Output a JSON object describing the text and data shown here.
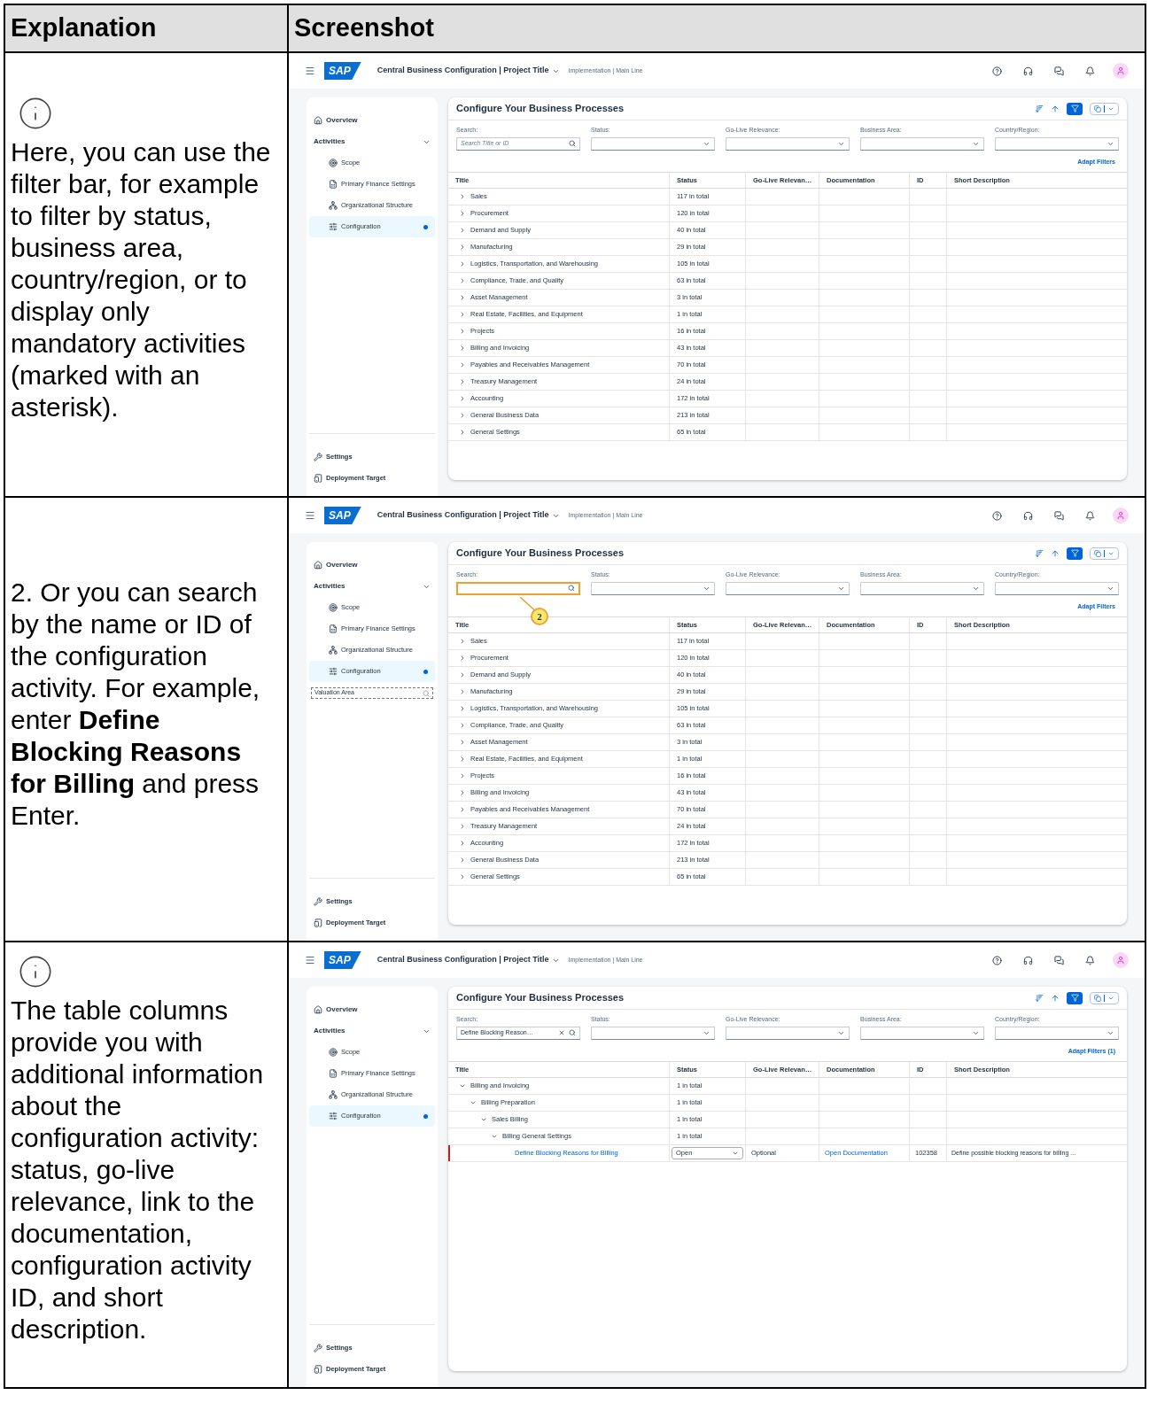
{
  "header": {
    "column_1": "Explanation",
    "column_2": "Screenshot"
  },
  "rows": [
    {
      "kind": "note",
      "explanation": "Here, you can use the filter bar, for example to filter by status, business area, country/region, or to display only mandatory activities (marked with an asterisk).",
      "screenshot": {
        "logo": "SAP",
        "app_title": "Central Business Configuration | Project Title",
        "subtitle": "Implementation | Main Line",
        "sidebar": {
          "items": [
            {
              "label": "Overview",
              "kind": "link",
              "selected": false
            },
            {
              "label": "Activities",
              "kind": "group",
              "expanded": true,
              "children": [
                {
                  "label": "Scope",
                  "selected": false
                },
                {
                  "label": "Primary Finance Settings",
                  "selected": false
                },
                {
                  "label": "Organizational Structure",
                  "selected": false
                },
                {
                  "label": "Configuration",
                  "selected": true
                }
              ]
            }
          ],
          "bottom_items": [
            "Settings",
            "Deployment Target"
          ]
        },
        "page_title": "Configure Your Business Processes",
        "filters": [
          {
            "kind": "search",
            "label": "Search:",
            "placeholder": "Search Title or ID",
            "highlighted": false
          },
          {
            "kind": "select",
            "label": "Status:"
          },
          {
            "kind": "select",
            "label": "Go-Live Relevance:"
          },
          {
            "kind": "select",
            "label": "Business Area:"
          },
          {
            "kind": "select",
            "label": "Country/Region:"
          }
        ],
        "adapt_filters": "Adapt Filters",
        "columns": [
          "Title",
          "Status",
          "Go-Live Relevan…",
          "Documentation",
          "ID",
          "Short Description"
        ],
        "tree": [
          {
            "kind": "group",
            "title": "Sales",
            "status": "117 in total",
            "expanded": false
          },
          {
            "kind": "group",
            "title": "Procurement",
            "status": "120 in total",
            "expanded": false
          },
          {
            "kind": "group",
            "title": "Demand and Supply",
            "status": "40 in total",
            "expanded": false
          },
          {
            "kind": "group",
            "title": "Manufacturing",
            "status": "29 in total",
            "expanded": false
          },
          {
            "kind": "group",
            "title": "Logistics, Transportation, and Warehousing",
            "status": "105 in total",
            "expanded": false
          },
          {
            "kind": "group",
            "title": "Compliance, Trade, and Quality",
            "status": "63 in total",
            "expanded": false
          },
          {
            "kind": "group",
            "title": "Asset Management",
            "status": "3 in total",
            "expanded": false
          },
          {
            "kind": "group",
            "title": "Real Estate, Facilities, and Equipment",
            "status": "1 in total",
            "expanded": false
          },
          {
            "kind": "group",
            "title": "Projects",
            "status": "16 in total",
            "expanded": false
          },
          {
            "kind": "group",
            "title": "Billing and Invoicing",
            "status": "43 in total",
            "expanded": false
          },
          {
            "kind": "group",
            "title": "Payables and Receivables Management",
            "status": "70 in total",
            "expanded": false
          },
          {
            "kind": "group",
            "title": "Treasury Management",
            "status": "24 in total",
            "expanded": false
          },
          {
            "kind": "group",
            "title": "Accounting",
            "status": "172 in total",
            "expanded": false
          },
          {
            "kind": "group",
            "title": "General Business Data",
            "status": "213 in total",
            "expanded": false
          },
          {
            "kind": "group",
            "title": "General Settings",
            "status": "65 in total",
            "expanded": false
          }
        ]
      }
    },
    {
      "kind": "step",
      "explanation": "2. Or you can search by the name or ID of the configuration activity. For example, enter **Define Blocking Reasons for Billing** and press Enter.",
      "screenshot": {
        "logo": "SAP",
        "app_title": "Central Business Configuration | Project Title",
        "subtitle": "Implementation | Main Line",
        "sidebar": {
          "items": [
            {
              "label": "Overview",
              "kind": "link",
              "selected": false
            },
            {
              "label": "Activities",
              "kind": "group",
              "expanded": true,
              "children": [
                {
                  "label": "Scope",
                  "selected": false
                },
                {
                  "label": "Primary Finance Settings",
                  "selected": false
                },
                {
                  "label": "Organizational Structure",
                  "selected": false
                },
                {
                  "label": "Configuration",
                  "selected": true
                }
              ]
            }
          ],
          "search_value": "Valuation Area",
          "bottom_items": [
            "Settings",
            "Deployment Target"
          ]
        },
        "page_title": "Configure Your Business Processes",
        "filters": [
          {
            "kind": "search",
            "label": "Search:",
            "highlighted": true,
            "callout": "2"
          },
          {
            "kind": "select",
            "label": "Status:"
          },
          {
            "kind": "select",
            "label": "Go-Live Relevance:"
          },
          {
            "kind": "select",
            "label": "Business Area:"
          },
          {
            "kind": "select",
            "label": "Country/Region:"
          }
        ],
        "adapt_filters": "Adapt Filters",
        "columns": [
          "Title",
          "Status",
          "Go-Live Relevan…",
          "Documentation",
          "ID",
          "Short Description"
        ],
        "tree": [
          {
            "kind": "group",
            "title": "Sales",
            "status": "117 in total",
            "expanded": false
          },
          {
            "kind": "group",
            "title": "Procurement",
            "status": "120 in total",
            "expanded": false
          },
          {
            "kind": "group",
            "title": "Demand and Supply",
            "status": "40 in total",
            "expanded": false
          },
          {
            "kind": "group",
            "title": "Manufacturing",
            "status": "29 in total",
            "expanded": false
          },
          {
            "kind": "group",
            "title": "Logistics, Transportation, and Warehousing",
            "status": "105 in total",
            "expanded": false
          },
          {
            "kind": "group",
            "title": "Compliance, Trade, and Quality",
            "status": "63 in total",
            "expanded": false
          },
          {
            "kind": "group",
            "title": "Asset Management",
            "status": "3 in total",
            "expanded": false
          },
          {
            "kind": "group",
            "title": "Real Estate, Facilities, and Equipment",
            "status": "1 in total",
            "expanded": false
          },
          {
            "kind": "group",
            "title": "Projects",
            "status": "16 in total",
            "expanded": false
          },
          {
            "kind": "group",
            "title": "Billing and Invoicing",
            "status": "43 in total",
            "expanded": false
          },
          {
            "kind": "group",
            "title": "Payables and Receivables Management",
            "status": "70 in total",
            "expanded": false
          },
          {
            "kind": "group",
            "title": "Treasury Management",
            "status": "24 in total",
            "expanded": false
          },
          {
            "kind": "group",
            "title": "Accounting",
            "status": "172 in total",
            "expanded": false
          },
          {
            "kind": "group",
            "title": "General Business Data",
            "status": "213 in total",
            "expanded": false
          },
          {
            "kind": "group",
            "title": "General Settings",
            "status": "65 in total",
            "expanded": false
          }
        ]
      }
    },
    {
      "kind": "note",
      "explanation": "The table columns provide you with additional information about the configuration activity: status, go-live relevance, link to the documentation, configuration activity ID, and short description.",
      "screenshot": {
        "logo": "SAP",
        "app_title": "Central Business Configuration | Project Title",
        "subtitle": "Implementation | Main Line",
        "sidebar": {
          "items": [
            {
              "label": "Overview",
              "kind": "link",
              "selected": false
            },
            {
              "label": "Activities",
              "kind": "group",
              "expanded": true,
              "children": [
                {
                  "label": "Scope",
                  "selected": false
                },
                {
                  "label": "Primary Finance Settings",
                  "selected": false
                },
                {
                  "label": "Organizational Structure",
                  "selected": false
                },
                {
                  "label": "Configuration",
                  "selected": true
                }
              ]
            }
          ],
          "bottom_items": [
            "Settings",
            "Deployment Target"
          ]
        },
        "page_title": "Configure Your Business Processes",
        "filters": [
          {
            "kind": "search",
            "label": "Search:",
            "value": "Define Blocking Reason…",
            "highlighted": false
          },
          {
            "kind": "select",
            "label": "Status:"
          },
          {
            "kind": "select",
            "label": "Go-Live Relevance:"
          },
          {
            "kind": "select",
            "label": "Business Area:"
          },
          {
            "kind": "select",
            "label": "Country/Region:"
          }
        ],
        "adapt_filters": "Adapt Filters (1)",
        "columns": [
          "Title",
          "Status",
          "Go-Live Relevan…",
          "Documentation",
          "ID",
          "Short Description"
        ],
        "tree": [
          {
            "kind": "group",
            "title": "Billing and Invoicing",
            "status": "1 in total",
            "expanded": true,
            "children": [
              {
                "kind": "group",
                "title": "Billing Preparation",
                "status": "1 in total",
                "expanded": true,
                "children": [
                  {
                    "kind": "group",
                    "title": "Sales Billing",
                    "status": "1 in total",
                    "expanded": true,
                    "children": [
                      {
                        "kind": "group",
                        "title": "Billing General Settings",
                        "status": "1 in total",
                        "expanded": true,
                        "children": [
                          {
                            "kind": "activity",
                            "title": "Define Blocking Reasons for Billing",
                            "status": "Open",
                            "go_live": "Optional",
                            "documentation": "Open Documentation",
                            "id": "102358",
                            "description": "Define possible blocking reasons for billing ..."
                          }
                        ]
                      }
                    ]
                  }
                ]
              }
            ]
          }
        ]
      }
    }
  ]
}
